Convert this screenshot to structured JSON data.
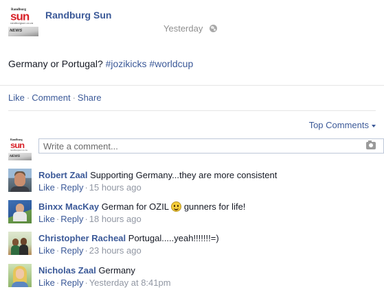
{
  "post": {
    "page_name": "Randburg Sun",
    "logo": {
      "small": "Randburg",
      "word": "sun",
      "url": "randburgsun.co.za",
      "news": "NEWS"
    },
    "time": "Yesterday",
    "text_plain": "Germany or Portugal? ",
    "hashtag_1": "#jozikicks",
    "hashtag_2": "#worldcup"
  },
  "actions": {
    "like": "Like",
    "comment": "Comment",
    "share": "Share",
    "sep": "·"
  },
  "sort": {
    "label": "Top Comments"
  },
  "composer": {
    "placeholder": "Write a comment..."
  },
  "comments": [
    {
      "author": "Robert Zaal",
      "text": "Supporting Germany...they are more consistent",
      "like": "Like",
      "reply": "Reply",
      "time": "15 hours ago"
    },
    {
      "author": "Binxx MacKay",
      "text": "German for OZIL",
      "text_after": "gunners for life!",
      "like": "Like",
      "reply": "Reply",
      "time": "18 hours ago"
    },
    {
      "author": "Christopher Racheal",
      "text": "Portugal.....yeah!!!!!!!=)",
      "like": "Like",
      "reply": "Reply",
      "time": "23 hours ago"
    },
    {
      "author": "Nicholas Zaal",
      "text": "Germany",
      "like": "Like",
      "reply": "Reply",
      "time": "Yesterday at 8:41pm"
    }
  ],
  "colors": {
    "link": "#3b5998",
    "meta": "#9197a3",
    "text": "#141823",
    "brand_red": "#d8232a"
  },
  "icons": {
    "privacy": "globe-icon",
    "attach": "camera-icon",
    "emoji": "smiley-icon",
    "sort": "caret-down-icon"
  }
}
